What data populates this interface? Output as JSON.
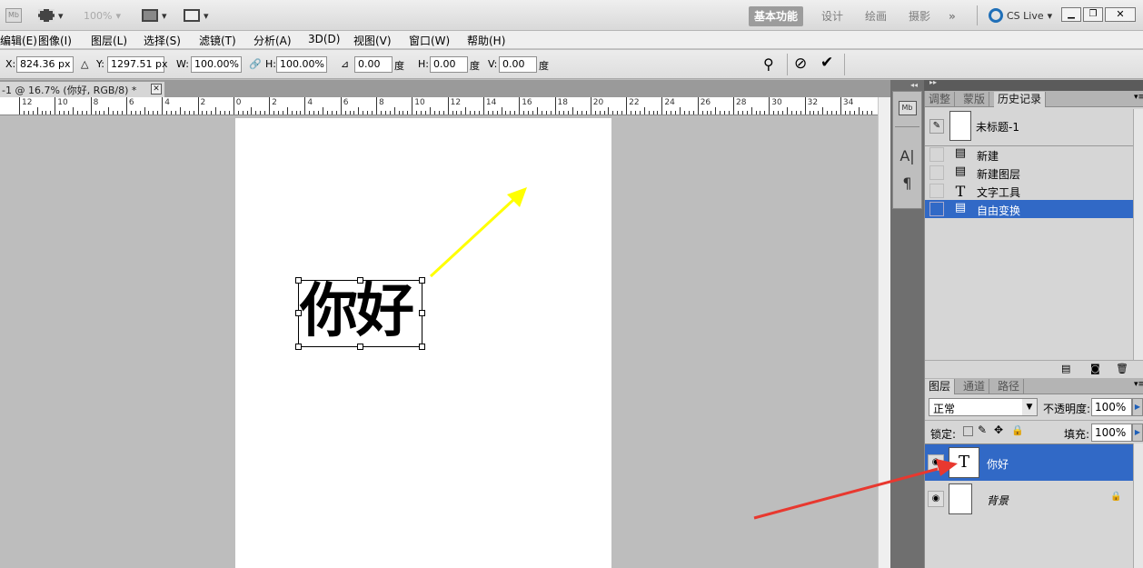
{
  "appbar": {
    "zoom": "100%",
    "workspaces": [
      "基本功能",
      "设计",
      "绘画",
      "摄影"
    ],
    "more": "»",
    "cs_live": "CS Live"
  },
  "menu": [
    "编辑(E)",
    "图像(I)",
    "图层(L)",
    "选择(S)",
    "滤镜(T)",
    "分析(A)",
    "3D(D)",
    "视图(V)",
    "窗口(W)",
    "帮助(H)"
  ],
  "options": {
    "x_label": "X:",
    "x_value": "824.36 px",
    "y_label": "Y:",
    "y_value": "1297.51 px",
    "w_label": "W:",
    "w_value": "100.00%",
    "h_label": "H:",
    "h_value": "100.00%",
    "angle_value": "0.00",
    "angle_unit": "度",
    "hskew_label": "H:",
    "hskew_value": "0.00",
    "hskew_unit": "度",
    "vskew_label": "V:",
    "vskew_value": "0.00",
    "vskew_unit": "度"
  },
  "document": {
    "tab_title": "-1 @ 16.7% (你好, RGB/8) *",
    "text": "你好",
    "ruler": [
      "12",
      "10",
      "8",
      "6",
      "4",
      "2",
      "0",
      "2",
      "4",
      "6",
      "8",
      "10",
      "12",
      "14",
      "16",
      "18",
      "20",
      "22",
      "24",
      "26",
      "28",
      "30",
      "32",
      "34"
    ]
  },
  "history": {
    "tabs": [
      "调整",
      "蒙版",
      "历史记录"
    ],
    "snapshot": "未标题-1",
    "items": [
      "新建",
      "新建图层",
      "文字工具",
      "自由变换"
    ]
  },
  "layers": {
    "tabs": [
      "图层",
      "通道",
      "路径"
    ],
    "blend_mode": "正常",
    "opacity_label": "不透明度:",
    "opacity": "100%",
    "lock_label": "锁定:",
    "fill_label": "填充:",
    "fill": "100%",
    "items": [
      "你好",
      "背景"
    ]
  },
  "colors": {
    "arrow_yellow": "#ffff00",
    "arrow_red": "#e8382f",
    "selection_blue": "#3169c6"
  }
}
